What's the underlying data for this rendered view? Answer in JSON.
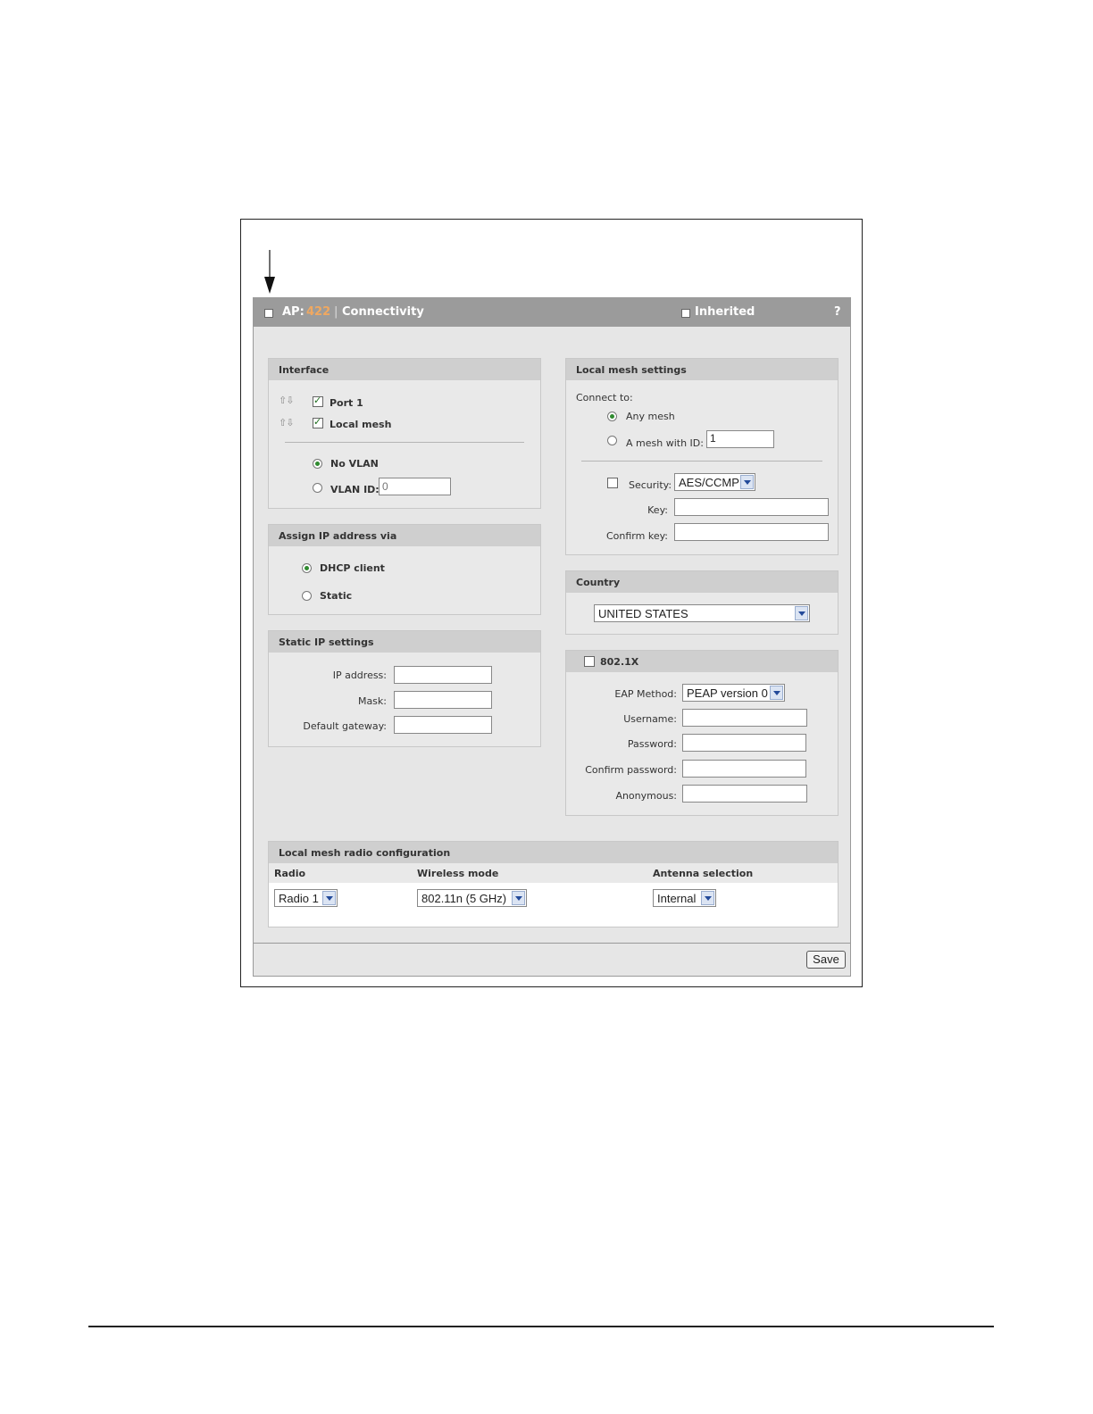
{
  "header": {
    "ap_prefix": "AP:",
    "ap_number": "422",
    "divider": "|",
    "page_name": "Connectivity",
    "inherited_label": "Inherited",
    "help_label": "?"
  },
  "interface": {
    "title": "Interface",
    "port1_label": "Port 1",
    "local_mesh_label": "Local mesh",
    "no_vlan_label": "No VLAN",
    "vlan_id_label": "VLAN ID:",
    "vlan_id_placeholder": "0"
  },
  "assign_ip": {
    "title": "Assign IP address via",
    "dhcp_label": "DHCP client",
    "static_label": "Static"
  },
  "static_ip": {
    "title": "Static IP settings",
    "ip_label": "IP address:",
    "mask_label": "Mask:",
    "gateway_label": "Default gateway:"
  },
  "local_mesh": {
    "title": "Local mesh settings",
    "connect_to_label": "Connect to:",
    "any_mesh_label": "Any mesh",
    "mesh_with_id_label": "A mesh with ID:",
    "mesh_id_value": "1",
    "security_label": "Security:",
    "security_value": "AES/CCMP",
    "key_label": "Key:",
    "confirm_key_label": "Confirm key:"
  },
  "country": {
    "title": "Country",
    "value": "UNITED STATES"
  },
  "dot1x": {
    "title": "802.1X",
    "eap_method_label": "EAP Method:",
    "eap_method_value": "PEAP version 0",
    "username_label": "Username:",
    "password_label": "Password:",
    "confirm_password_label": "Confirm password:",
    "anonymous_label": "Anonymous:"
  },
  "radio_config": {
    "title": "Local mesh radio configuration",
    "col_radio": "Radio",
    "col_wireless_mode": "Wireless mode",
    "col_antenna": "Antenna selection",
    "radio_value": "Radio 1",
    "wireless_mode_value": "802.11n (5 GHz)",
    "antenna_value": "Internal"
  },
  "footer": {
    "save_label": "Save"
  },
  "colors": {
    "title_bar": "#9b9b9b",
    "ap_number": "#f0a860",
    "panel_header": "#cfcfcf",
    "panel_body": "#e9e9e9"
  }
}
